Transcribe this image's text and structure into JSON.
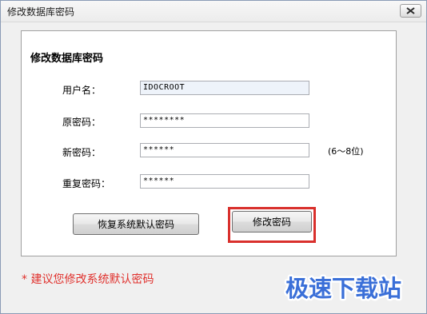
{
  "window": {
    "title": "修改数据库密码",
    "close_symbol": "X"
  },
  "panel": {
    "title": "修改数据库密码"
  },
  "form": {
    "username_label": "用户名：",
    "username_value": "IDOCROOT",
    "old_password_label": "原密码：",
    "old_password_value": "********",
    "new_password_label": "新密码：",
    "new_password_value": "******",
    "new_password_hint": "(6～8位)",
    "repeat_password_label": "重复密码：",
    "repeat_password_value": "******"
  },
  "buttons": {
    "restore_default": "恢复系统默认密码",
    "change_password": "修改密码"
  },
  "warning": {
    "text": "* 建议您修改系统默认密码"
  },
  "watermark": {
    "text": "极速下载站"
  },
  "colors": {
    "warning": "#e0302c",
    "highlight": "#d9302c",
    "watermark": "#3a6fd8"
  }
}
